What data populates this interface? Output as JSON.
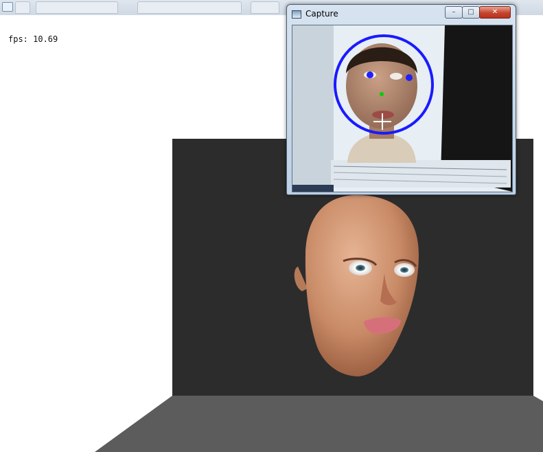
{
  "viewer": {
    "fps_text": "fps: 10.69"
  },
  "capture_window": {
    "title": "Capture",
    "minimize_glyph": "–",
    "maximize_glyph": "□",
    "close_glyph": "✕"
  },
  "colors": {
    "backdrop_dark": "#2c2c2c",
    "floor_gray": "#5c5c5c",
    "skin": "#c98b67",
    "tracking_circle": "#1a1aff",
    "eye_marker": "#2020ff",
    "nose_marker": "#00d000",
    "crosshair": "#ffffff"
  }
}
